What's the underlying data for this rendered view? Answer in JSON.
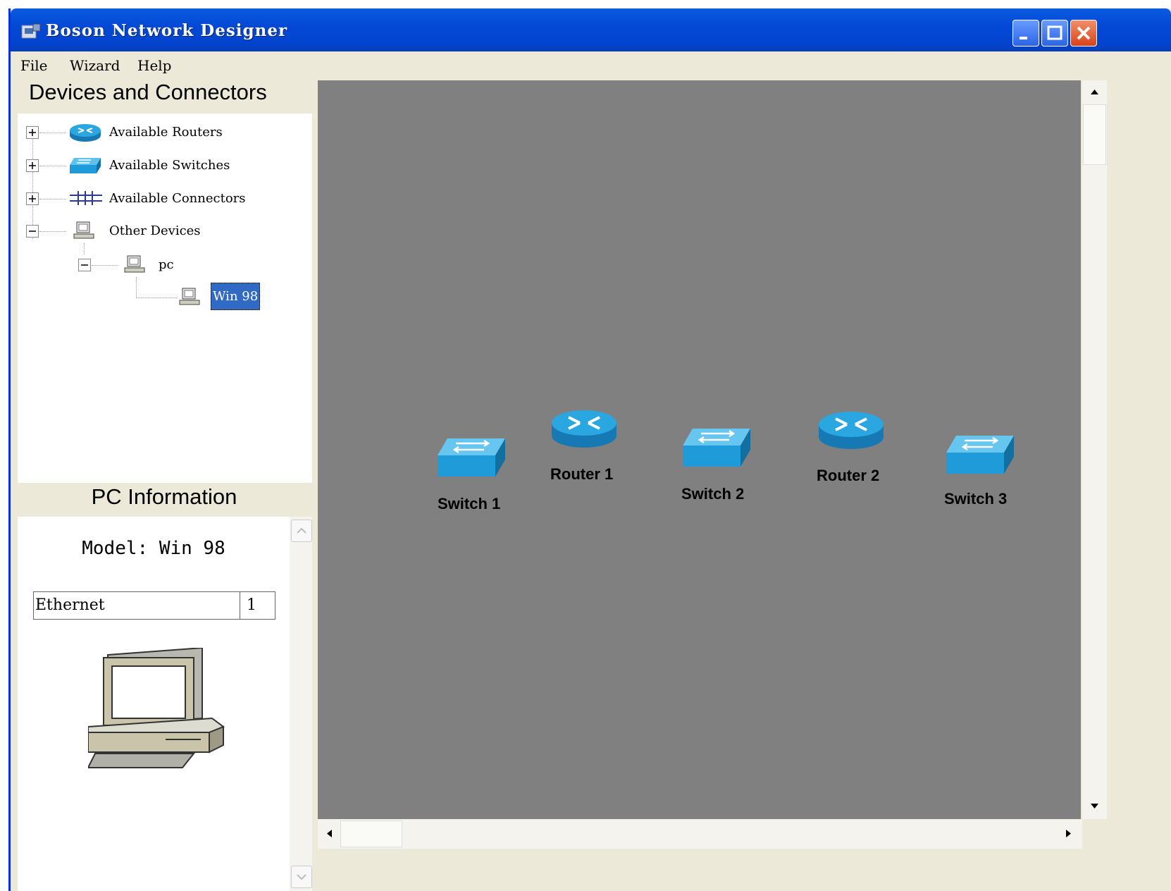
{
  "window": {
    "title": "Boson Network Designer",
    "controls": [
      "minimize",
      "maximize",
      "close"
    ]
  },
  "menu": {
    "file": "File",
    "wizard": "Wizard",
    "help": "Help"
  },
  "devices_panel": {
    "title": "Devices and Connectors",
    "tree": {
      "routers": "Available Routers",
      "switches": "Available Switches",
      "connectors": "Available Connectors",
      "other": "Other Devices",
      "pc": "pc",
      "win98": "Win 98"
    }
  },
  "info_panel": {
    "title": "PC Information",
    "model": "Model: Win 98",
    "port_name": "Ethernet",
    "port_count": "1"
  },
  "topology": {
    "switch1": "Switch 1",
    "router1": "Router 1",
    "switch2": "Switch 2",
    "router2": "Router 2",
    "switch3": "Switch 3"
  },
  "colors": {
    "titlebar": "#0349d6",
    "canvas": "#808080",
    "device_blue": "#1e9bd8",
    "selection": "#316ac5"
  },
  "icons": [
    "window-app-icon",
    "router-icon",
    "switch-icon",
    "connector-icon",
    "pc-icon"
  ]
}
